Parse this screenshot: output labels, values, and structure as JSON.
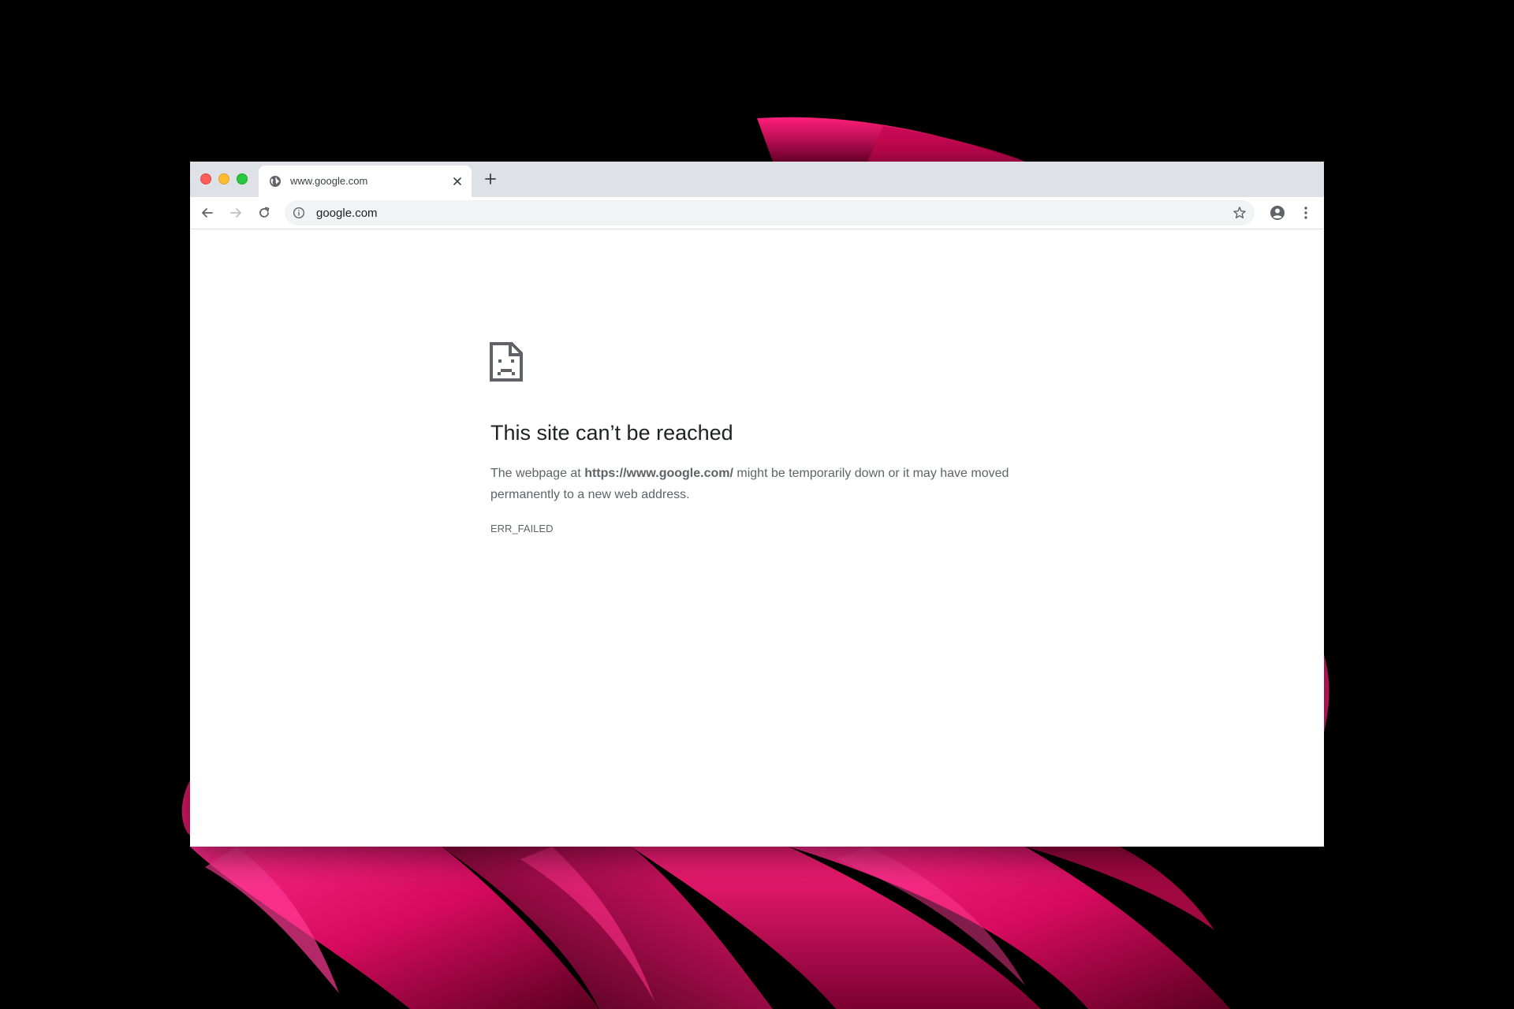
{
  "colors": {
    "background": "#000000",
    "wallpaper_accent": "#e0106e",
    "tabstrip": "#dee1e6",
    "omnibox": "#f1f3f4",
    "title_text": "#202124",
    "body_text": "#5f6368"
  },
  "window_controls": {
    "close_icon": "traffic-light-close-icon",
    "minimize_icon": "traffic-light-minimize-icon",
    "zoom_icon": "traffic-light-zoom-icon"
  },
  "tab": {
    "favicon": "globe-icon",
    "title": "www.google.com",
    "close_icon": "close-icon"
  },
  "new_tab_icon": "plus-icon",
  "toolbar": {
    "back_icon": "arrow-left-icon",
    "forward_icon": "arrow-right-icon",
    "reload_icon": "reload-icon",
    "site_info_icon": "info-icon",
    "url": "google.com",
    "bookmark_icon": "star-icon",
    "profile_icon": "account-circle-icon",
    "menu_icon": "kebab-menu-icon"
  },
  "error": {
    "icon": "sad-document-icon",
    "title": "This site can’t be reached",
    "desc_prefix": "The webpage at ",
    "desc_url": "https://www.google.com/",
    "desc_suffix": " might be temporarily down or it may have moved permanently to a new web address.",
    "code": "ERR_FAILED"
  }
}
